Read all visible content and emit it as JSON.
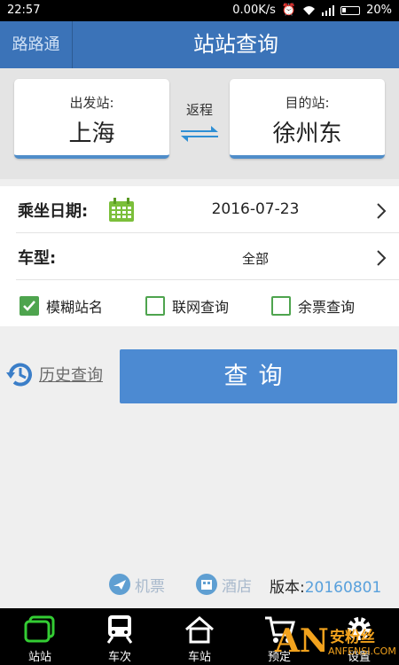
{
  "status_bar": {
    "time": "22:57",
    "speed": "0.00K/s",
    "battery": "20%"
  },
  "header": {
    "brand": "路路通",
    "title": "站站查询"
  },
  "stations": {
    "from_label": "出发站:",
    "from_value": "上海",
    "to_label": "目的站:",
    "to_value": "徐州东",
    "round_trip": "返程"
  },
  "form": {
    "date_label": "乘坐日期:",
    "date_value": "2016-07-23",
    "type_label": "车型:",
    "type_value": "全部",
    "checks": [
      {
        "label": "模糊站名",
        "checked": true
      },
      {
        "label": "联网查询",
        "checked": false
      },
      {
        "label": "余票查询",
        "checked": false
      }
    ]
  },
  "actions": {
    "history": "历史查询",
    "query": "查询"
  },
  "footer": {
    "flight": "机票",
    "hotel": "酒店",
    "version_label": "版本:",
    "version_value": "20160801"
  },
  "nav": [
    {
      "label": "站站",
      "icon": "station-to-station-icon"
    },
    {
      "label": "车次",
      "icon": "train-icon"
    },
    {
      "label": "车站",
      "icon": "home-station-icon"
    },
    {
      "label": "预定",
      "icon": "cart-icon"
    },
    {
      "label": "设置",
      "icon": "gear-icon"
    }
  ],
  "watermark": {
    "logo": "AN",
    "name": "安粉丝",
    "site": "ANFENSI.COM"
  },
  "colors": {
    "header": "#3b73b8",
    "button": "#4c8ad2",
    "check": "#4ea44e",
    "nav_active": "#33cc33"
  }
}
